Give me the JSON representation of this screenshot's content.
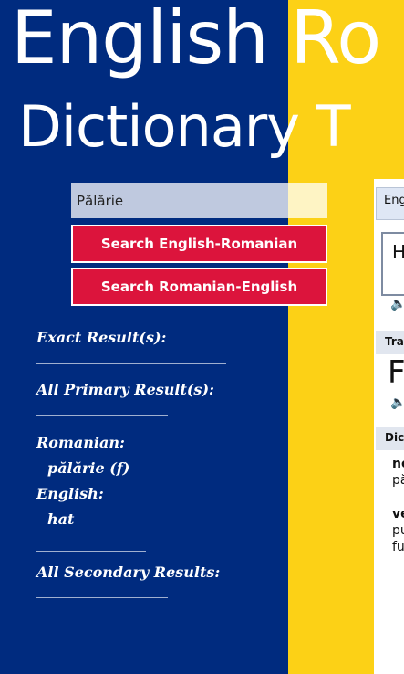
{
  "colors": {
    "blue": "#002b7f",
    "yellow": "#fcd116",
    "red": "#dc143c",
    "white": "#ffffff"
  },
  "title": {
    "line1": "English  Ro",
    "line2": "Dictionary   T"
  },
  "search": {
    "value": "Pălărie",
    "btn_en_ro": "Search English-Romanian",
    "btn_ro_en": "Search Romanian-English"
  },
  "results": {
    "exact_label": "Exact Result(s):",
    "exact_dashes": "__________________________",
    "primary_label": "All Primary Result(s):",
    "primary_dashes": "__________________",
    "romanian_label": "Romanian:",
    "romanian_word": "pălărie (f)",
    "english_label": "English:",
    "english_word": "hat",
    "mid_dashes": "_______________",
    "secondary_label": "All Secondary Results:",
    "secondary_dashes": "__________________"
  },
  "right_panel": {
    "lang_label": "Engl",
    "input_text": "H",
    "section1": "Tra",
    "big_text": "F",
    "section2": "Dic",
    "entry1_head": "no",
    "entry1_text": "pă",
    "entry2_head": "ve",
    "entry2_line1": "pu",
    "entry2_line2": "fu",
    "speaker_icon": "🔈"
  }
}
